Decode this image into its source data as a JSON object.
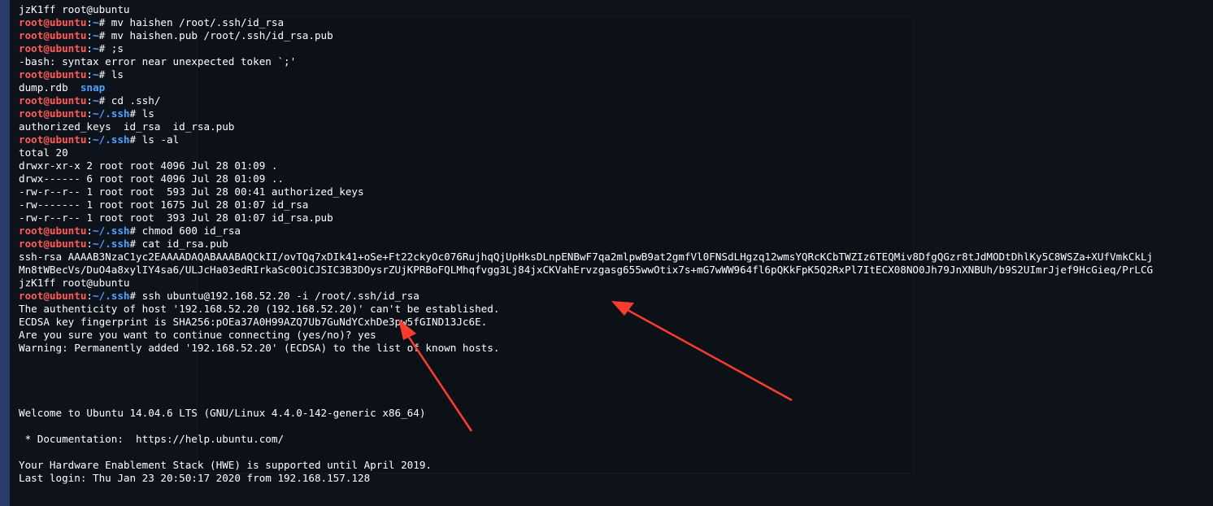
{
  "prompt": {
    "user": "root@ubuntu",
    "sep": ":",
    "home": "~",
    "ssh": "~/.ssh",
    "end": "# "
  },
  "history": [
    {
      "kind": "text",
      "text": "jzK1ff root@ubuntu"
    },
    {
      "kind": "cmd",
      "dir": "home",
      "cmd": "mv haishen /root/.ssh/id_rsa"
    },
    {
      "kind": "cmd",
      "dir": "home",
      "cmd": "mv haishen.pub /root/.ssh/id_rsa.pub"
    },
    {
      "kind": "cmd",
      "dir": "home",
      "cmd": ";s"
    },
    {
      "kind": "text",
      "text": "-bash: syntax error near unexpected token `;'"
    },
    {
      "kind": "cmd",
      "dir": "home",
      "cmd": "ls"
    },
    {
      "kind": "ls",
      "items": [
        "dump.rdb",
        "snap"
      ]
    },
    {
      "kind": "cmd",
      "dir": "home",
      "cmd": "cd .ssh/"
    },
    {
      "kind": "cmd",
      "dir": "ssh",
      "cmd": "ls"
    },
    {
      "kind": "text",
      "text": "authorized_keys  id_rsa  id_rsa.pub"
    },
    {
      "kind": "cmd",
      "dir": "ssh",
      "cmd": "ls -al"
    },
    {
      "kind": "text",
      "text": "total 20"
    },
    {
      "kind": "text",
      "text": "drwxr-xr-x 2 root root 4096 Jul 28 01:09 ."
    },
    {
      "kind": "text",
      "text": "drwx------ 6 root root 4096 Jul 28 01:09 .."
    },
    {
      "kind": "text",
      "text": "-rw-r--r-- 1 root root  593 Jul 28 00:41 authorized_keys"
    },
    {
      "kind": "text",
      "text": "-rw------- 1 root root 1675 Jul 28 01:07 id_rsa"
    },
    {
      "kind": "text",
      "text": "-rw-r--r-- 1 root root  393 Jul 28 01:07 id_rsa.pub"
    },
    {
      "kind": "cmd",
      "dir": "ssh",
      "cmd": "chmod 600 id_rsa"
    },
    {
      "kind": "cmd",
      "dir": "ssh",
      "cmd": "cat id_rsa.pub"
    },
    {
      "kind": "text",
      "text": "ssh-rsa AAAAB3NzaC1yc2EAAAADAQABAAABAQCkII/ovTQq7xDIk41+oSe+Ft22ckyOc076RujhqQjUpHksDLnpENBwF7qa2mlpwB9at2gmfVl0FNSdLHgzq12wmsYQRcKCbTWZIz6TEQMiv8DfgQGzr8tJdMODtDhlKy5C8WSZa+XUfVmkCkLj"
    },
    {
      "kind": "text",
      "text": "Mn8tWBecVs/DuO4a8xylIY4sa6/ULJcHa03edRIrkaSc0OiCJSIC3B3DOysrZUjKPRBoFQLMhqfvgg3Lj84jxCKVahErvzgasg655wwOtix7s+mG7wWW964fl6pQKkFpK5Q2RxPl7ItECX08NO0Jh79JnXNBUh/b9S2UImrJjef9HcGieq/PrLCG"
    },
    {
      "kind": "text",
      "text": "jzK1ff root@ubuntu"
    },
    {
      "kind": "cmd",
      "dir": "ssh",
      "cmd": "ssh ubuntu@192.168.52.20 -i /root/.ssh/id_rsa"
    },
    {
      "kind": "text",
      "text": "The authenticity of host '192.168.52.20 (192.168.52.20)' can't be established."
    },
    {
      "kind": "text",
      "text": "ECDSA key fingerprint is SHA256:pOEa37A0H99AZQ7Ub7GuNdYCxhDe3pw5fGIND13Jc6E."
    },
    {
      "kind": "text",
      "text": "Are you sure you want to continue connecting (yes/no)? yes"
    },
    {
      "kind": "text",
      "text": "Warning: Permanently added '192.168.52.20' (ECDSA) to the list of known hosts."
    },
    {
      "kind": "blank"
    },
    {
      "kind": "blank"
    },
    {
      "kind": "blank"
    },
    {
      "kind": "blank"
    },
    {
      "kind": "text",
      "text": "Welcome to Ubuntu 14.04.6 LTS (GNU/Linux 4.4.0-142-generic x86_64)"
    },
    {
      "kind": "blank"
    },
    {
      "kind": "text",
      "text": " * Documentation:  https://help.ubuntu.com/"
    },
    {
      "kind": "blank"
    },
    {
      "kind": "text",
      "text": "Your Hardware Enablement Stack (HWE) is supported until April 2019."
    },
    {
      "kind": "text",
      "text": "Last login: Thu Jan 23 20:50:17 2020 from 192.168.157.128"
    }
  ]
}
